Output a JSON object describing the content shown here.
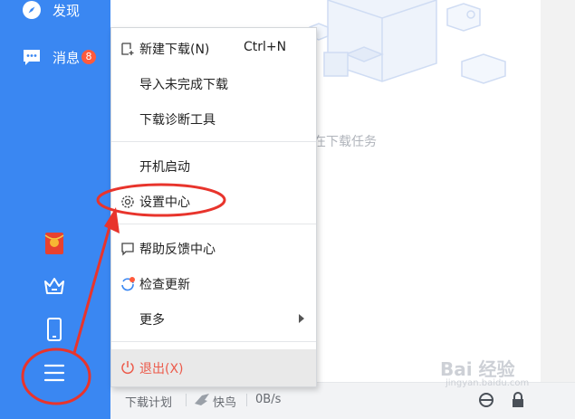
{
  "sidebar": {
    "discover_label": "发现",
    "messages_label": "消息",
    "messages_badge": "8"
  },
  "main": {
    "empty_text": "在下载任务"
  },
  "menu": {
    "items": [
      {
        "label": "新建下载(N)",
        "shortcut": "Ctrl+N",
        "icon": "new-download-icon"
      },
      {
        "label": "导入未完成下载"
      },
      {
        "label": "下载诊断工具"
      },
      {
        "label": "开机启动"
      },
      {
        "label": "设置中心",
        "icon": "gear-icon"
      },
      {
        "label": "帮助反馈中心",
        "icon": "feedback-icon"
      },
      {
        "label": "检查更新",
        "icon": "refresh-icon"
      },
      {
        "label": "更多",
        "has_submenu": true
      },
      {
        "label": "退出(X)",
        "icon": "power-icon"
      }
    ]
  },
  "statusbar": {
    "plan_label": "下载计划",
    "speed_mode_label": "快鸟",
    "speed_value": "0B/s"
  },
  "watermark": {
    "main": "Bai 经验",
    "sub": "jingyan.baidu.com"
  },
  "colors": {
    "sidebar_bg": "#3a87f2",
    "annotation_red": "#e8342c",
    "exit_red": "#ec5a4a",
    "badge_red": "#ff5a3c"
  }
}
